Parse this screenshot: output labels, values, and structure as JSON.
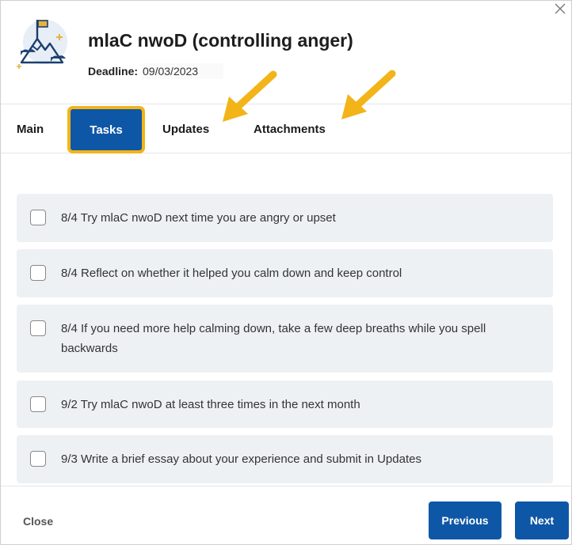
{
  "dialog": {
    "title": "mlaC nwoD (controlling anger)",
    "deadline_label": "Deadline:",
    "deadline_value": "09/03/2023",
    "icon": "mountain-flag-icon",
    "close_icon": "close-icon"
  },
  "tabs": [
    {
      "label": "Main",
      "active": false
    },
    {
      "label": "Tasks",
      "active": true
    },
    {
      "label": "Updates",
      "active": false
    },
    {
      "label": "Attachments",
      "active": false
    }
  ],
  "annotations": {
    "arrow_color": "#f2b418",
    "highlight_color": "#f2b418"
  },
  "tasks": [
    {
      "text": "8/4 Try mlaC nwoD next time you are angry or upset",
      "checked": false
    },
    {
      "text": "8/4 Reflect on whether it helped you calm down and keep control",
      "checked": false
    },
    {
      "text": "8/4 If you need more help calming down, take a few deep breaths while you spell backwards",
      "checked": false
    },
    {
      "text": "9/2 Try mlaC nwoD at least three times in the next month",
      "checked": false
    },
    {
      "text": "9/3 Write a brief essay about your experience and submit in Updates",
      "checked": false
    }
  ],
  "footer": {
    "close_label": "Close",
    "previous_label": "Previous",
    "next_label": "Next"
  },
  "colors": {
    "primary": "#0e57a6",
    "task_bg": "#eef1f4",
    "icon_navy": "#1b3f6e",
    "icon_gold": "#e8b33a"
  }
}
